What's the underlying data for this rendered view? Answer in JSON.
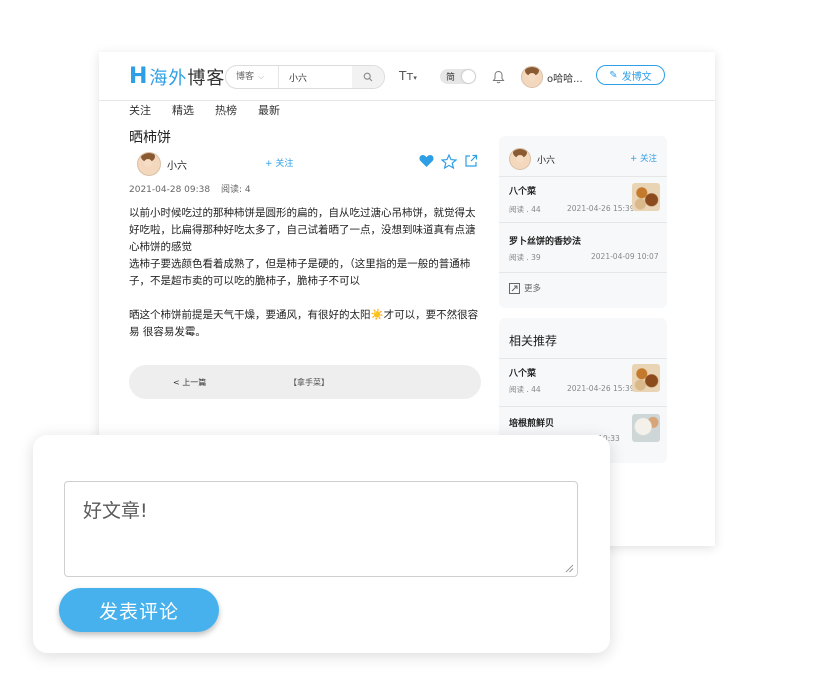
{
  "header": {
    "logo_h": "H",
    "logo_text_blue": "海外",
    "logo_text_rest": "博客",
    "search_type": "博客",
    "search_query": "小六",
    "font_icon": "Tт",
    "lang_toggle": "简",
    "username": "o哈哈...",
    "post_button": "发博文"
  },
  "nav": [
    "关注",
    "精选",
    "热榜",
    "最新"
  ],
  "article": {
    "title": "晒柿饼",
    "author": "小六",
    "follow": "+ 关注",
    "date": "2021-04-28 09:38",
    "reads": "阅读: 4",
    "paragraphs": [
      "以前小时候吃过的那种柿饼是圆形的扁的，自从吃过溏心吊柿饼，就觉得太好吃啦，比扁得那种好吃太多了，自己试着晒了一点，没想到味道真有点溏心柿饼的感觉",
      "选柿子要选颜色看着成熟了，但是柿子是硬的，（这里指的是一般的普通柿子，不是超市卖的可以吃的脆柿子，脆柿子不可以",
      "",
      "晒这个柿饼前提是天气干燥，要通风，有很好的太阳☀️才可以，要不然很容易 很容易发霉。"
    ],
    "prev": "< 上一篇",
    "category": "【拿手菜】"
  },
  "author_card": {
    "name": "小六",
    "follow": "+ 关注",
    "items": [
      {
        "title": "八个菜",
        "reads": "阅读 . 44",
        "date": "2021-04-26 15:39"
      },
      {
        "title": "罗卜丝饼的香妙法",
        "reads": "阅读 . 39",
        "date": "2021-04-09 10:07"
      }
    ],
    "more": "更多"
  },
  "related": {
    "heading": "相关推荐",
    "items": [
      {
        "title": "八个菜",
        "reads": "阅读 . 44",
        "date": "2021-04-26 15:39"
      },
      {
        "title": "培根煎鲜贝",
        "date": "1 10:33"
      }
    ]
  },
  "comment": {
    "value": "好文章!",
    "submit": "发表评论"
  },
  "colors": {
    "accent": "#2f9fe5",
    "button": "#46b1ec"
  }
}
